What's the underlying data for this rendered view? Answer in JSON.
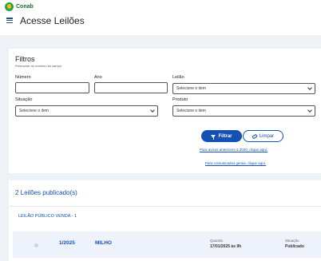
{
  "brand": {
    "logo_text": "Conab"
  },
  "header": {
    "title": "Acesse Leilões"
  },
  "filters": {
    "title": "Filtros",
    "hint": "Preencher no mínimo um campo",
    "numero_label": "Número",
    "numero_value": "",
    "ano_label": "Ano",
    "ano_value": "",
    "leilao_label": "Leilão",
    "leilao_selected": "Selecione o item",
    "situacao_label": "Situação",
    "situacao_selected": "Selecione o item",
    "produto_label": "Produto",
    "produto_selected": "Selecione o item",
    "filter_button": "Filtrar",
    "clear_button": "Limpar",
    "link_old": "Para avisos anteriores a 2020, clique aqui.",
    "link_general": "Para comunicados gerais, clique aqui."
  },
  "results": {
    "title": "2 Leilões publicado(s)",
    "sale_title": "LEILÃO PÚBLICO VENDA - 1",
    "rows": [
      {
        "number": "1/2025",
        "product": "MILHO",
        "when_label": "Quando",
        "when_value": "17/01/2025 às 9h",
        "status_label": "Situação",
        "status_value": "Publicado"
      }
    ]
  },
  "colors": {
    "primary": "#1351b4",
    "brand_green": "#2e9e4c",
    "background": "#eef1f5"
  }
}
